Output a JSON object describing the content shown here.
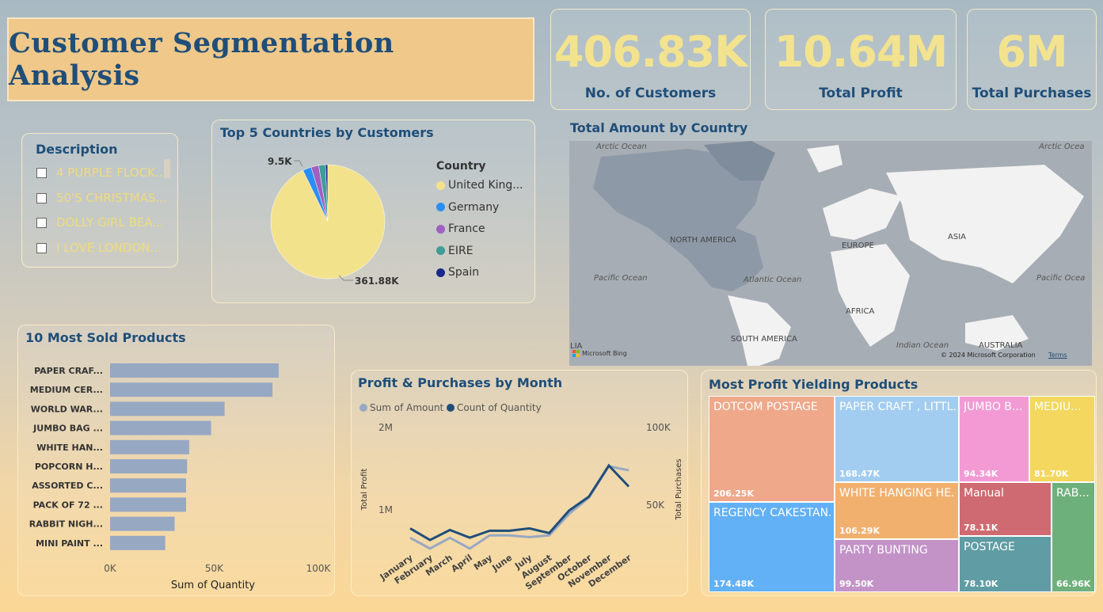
{
  "title": "Customer Segmentation Analysis",
  "kpis": [
    {
      "value": "406.83K",
      "label": "No. of Customers"
    },
    {
      "value": "10.64M",
      "label": "Total Profit"
    },
    {
      "value": "6M",
      "label": "Total Purchases"
    }
  ],
  "description": {
    "title": "Description",
    "items": [
      "4 PURPLE FLOCK...",
      "50'S CHRISTMAS...",
      "DOLLY GIRL BEA...",
      "I LOVE LONDON..."
    ]
  },
  "pie": {
    "title": "Top 5 Countries by Customers",
    "legend_title": "Country",
    "label_small": "9.5K",
    "label_large": "361.88K"
  },
  "map": {
    "title": "Total Amount by Country",
    "labels": {
      "arctic_left": "Arctic Ocean",
      "arctic_right": "Arctic Ocea",
      "north_america": "NORTH AMERICA",
      "europe": "EUROPE",
      "asia": "ASIA",
      "pacific_left": "Pacific Ocean",
      "atlantic": "Atlantic Ocean",
      "pacific_right": "Pacific Ocea",
      "africa": "AFRICA",
      "south_america": "SOUTH AMERICA",
      "indian": "Indian Ocean",
      "australia": "AUSTRALIA",
      "lia": "LIA",
      "bing": "Microsoft Bing",
      "copyright": "© 2024 Microsoft Corporation",
      "terms": "Terms"
    }
  },
  "bar_panel": {
    "title": "10 Most Sold Products"
  },
  "line_panel": {
    "title": "Profit & Purchases by Month"
  },
  "treemap": {
    "title": "Most Profit Yielding Products",
    "cells": [
      {
        "name": "DOTCOM POSTAGE",
        "value": "206.25K",
        "color": "#efa88a"
      },
      {
        "name": "REGENCY CAKESTAN...",
        "value": "174.48K",
        "color": "#62b0f5"
      },
      {
        "name": "PAPER CRAFT , LITTL...",
        "value": "168.47K",
        "color": "#a3cdf0"
      },
      {
        "name": "WHITE HANGING HE...",
        "value": "106.29K",
        "color": "#f2b06f"
      },
      {
        "name": "PARTY BUNTING",
        "value": "99.50K",
        "color": "#c393c8"
      },
      {
        "name": "JUMBO B...",
        "value": "94.34K",
        "color": "#f39ad5"
      },
      {
        "name": "MEDIU...",
        "value": "81.70K",
        "color": "#f3d75e"
      },
      {
        "name": "Manual",
        "value": "78.11K",
        "color": "#d06a72"
      },
      {
        "name": "POSTAGE",
        "value": "78.10K",
        "color": "#5f9ca3"
      },
      {
        "name": "RAB...",
        "value": "66.96K",
        "color": "#6db07b"
      }
    ]
  },
  "chart_data": [
    {
      "type": "pie",
      "title": "Top 5 Countries by Customers",
      "legend_title": "Country",
      "categories": [
        "United King...",
        "Germany",
        "France",
        "EIRE",
        "Spain"
      ],
      "values": [
        361.88,
        9.5,
        8.5,
        7.5,
        2.5
      ],
      "colors": [
        "#f3e28c",
        "#2b8ef5",
        "#a160c0",
        "#3f9c98",
        "#1a2a8a"
      ],
      "legend_placement": "right"
    },
    {
      "type": "bar",
      "orientation": "horizontal",
      "title": "10 Most Sold Products",
      "categories": [
        "PAPER CRAF...",
        "MEDIUM CER...",
        "WORLD WAR...",
        "JUMBO BAG ...",
        "WHITE HAN...",
        "POPCORN H...",
        "ASSORTED C...",
        "PACK OF 72 ...",
        "RABBIT NIGH...",
        "MINI PAINT ..."
      ],
      "values": [
        81000,
        78000,
        55000,
        48500,
        38000,
        37000,
        36500,
        36500,
        31000,
        26500
      ],
      "xlabel": "Sum of Quantity",
      "xlim": [
        0,
        100000
      ],
      "xticks": [
        "0K",
        "50K",
        "100K"
      ],
      "color": "#97a8c3"
    },
    {
      "type": "line",
      "title": "Profit & Purchases by Month",
      "categories": [
        "January",
        "February",
        "March",
        "April",
        "May",
        "June",
        "July",
        "August",
        "September",
        "October",
        "November",
        "December"
      ],
      "series": [
        {
          "name": "Sum of Amount",
          "axis": "left",
          "color": "#97a8c3",
          "values": [
            660000,
            530000,
            660000,
            530000,
            690000,
            690000,
            670000,
            690000,
            950000,
            1150000,
            1530000,
            1480000
          ]
        },
        {
          "name": "Count of Quantity",
          "axis": "right",
          "color": "#1f4e79",
          "values": [
            35000,
            27500,
            34000,
            29000,
            33500,
            33500,
            35000,
            32000,
            46500,
            55500,
            75500,
            62000
          ]
        }
      ],
      "ylabel_left": "Total Profit",
      "ylabel_right": "Total Purchases",
      "yticks_left": [
        "1M",
        "2M"
      ],
      "yticks_right": [
        "50K",
        "100K"
      ],
      "legend_placement": "top-left"
    }
  ]
}
